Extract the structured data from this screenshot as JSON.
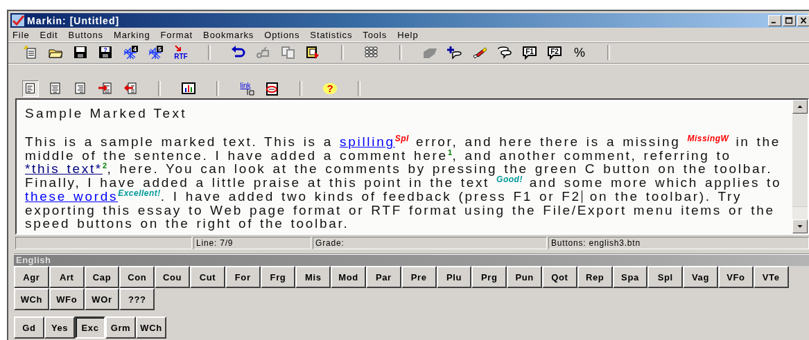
{
  "window": {
    "title": "Markin: [Untitled]"
  },
  "menu": [
    "File",
    "Edit",
    "Buttons",
    "Marking",
    "Format",
    "Bookmarks",
    "Options",
    "Statistics",
    "Tools",
    "Help"
  ],
  "toolbar_1": [
    {
      "kind": "new",
      "disabled": false
    },
    {
      "kind": "open",
      "disabled": false
    },
    {
      "kind": "save",
      "disabled": false
    },
    {
      "kind": "saveas",
      "label": "?",
      "disabled": false
    },
    {
      "kind": "web",
      "label": "4",
      "disabled": false
    },
    {
      "kind": "web",
      "label": "5",
      "disabled": false
    },
    {
      "kind": "rtf",
      "label": "RTF",
      "disabled": false
    },
    {
      "kind": "sep"
    },
    {
      "kind": "undo",
      "disabled": false
    },
    {
      "kind": "cut",
      "disabled": true
    },
    {
      "kind": "copy",
      "disabled": true
    },
    {
      "kind": "paste",
      "disabled": false
    },
    {
      "kind": "sep"
    },
    {
      "kind": "keypad",
      "disabled": false
    },
    {
      "kind": "sep"
    },
    {
      "kind": "shape",
      "disabled": true
    },
    {
      "kind": "addcomment",
      "disabled": false
    },
    {
      "kind": "highlight",
      "disabled": false
    },
    {
      "kind": "balloons",
      "disabled": false
    },
    {
      "kind": "fkey",
      "label": "F1",
      "disabled": false
    },
    {
      "kind": "fkey",
      "label": "F2",
      "disabled": false
    },
    {
      "kind": "percent",
      "label": "%",
      "disabled": false
    },
    {
      "kind": "sep"
    }
  ],
  "toolbar_2": [
    {
      "kind": "alignleft",
      "pressed": true
    },
    {
      "kind": "aligncenter",
      "pressed": false
    },
    {
      "kind": "alignright",
      "pressed": false
    },
    {
      "kind": "indent",
      "pressed": false
    },
    {
      "kind": "outdent",
      "pressed": false
    },
    {
      "kind": "sep"
    },
    {
      "kind": "chart",
      "pressed": false
    },
    {
      "kind": "sep"
    },
    {
      "kind": "link",
      "label": "link",
      "pressed": false
    },
    {
      "kind": "notepad",
      "pressed": false
    },
    {
      "kind": "sep"
    },
    {
      "kind": "help",
      "label": "?",
      "pressed": false
    },
    {
      "kind": "sep"
    }
  ],
  "editor": {
    "heading": "Sample Marked Text",
    "segments": [
      {
        "kind": "text",
        "text": "This is a sample marked text. This is a "
      },
      {
        "kind": "link",
        "text": "spilling",
        "color": "#0000ff"
      },
      {
        "kind": "mark",
        "text": "Spl",
        "color": "#ff0000"
      },
      {
        "kind": "text",
        "text": " error, and here there is a missing "
      },
      {
        "kind": "mark",
        "text": "MissingW",
        "color": "#ff0000"
      },
      {
        "kind": "text",
        "text": " in the middle of the sentence. I have added a comment here"
      },
      {
        "kind": "note",
        "text": "1",
        "color": "#008000"
      },
      {
        "kind": "text",
        "text": ", and another comment, referring to "
      },
      {
        "kind": "link",
        "text": "*this text*",
        "color": "#000080"
      },
      {
        "kind": "note",
        "text": "2",
        "color": "#008000"
      },
      {
        "kind": "text",
        "text": ", here. You can look at the comments by pressing the green C button on the toolbar. Finally, I have added a little praise at this point in the text "
      },
      {
        "kind": "mark",
        "text": "Good!",
        "color": "#009999"
      },
      {
        "kind": "text",
        "text": " and some more which applies to "
      },
      {
        "kind": "link",
        "text": "these words",
        "color": "#0000ff"
      },
      {
        "kind": "mark",
        "text": "Excellent!",
        "color": "#009999"
      },
      {
        "kind": "text",
        "text": ". I have added two kinds of feedback (press F1 or F2"
      },
      {
        "kind": "caret"
      },
      {
        "kind": "text",
        "text": " on the toolbar). Try exporting this essay to Web page format or RTF format using the File/Export menu items or the speed buttons on the right of the toolbar."
      }
    ]
  },
  "status_bar": {
    "line": "Line:  7/9",
    "grade": "Grade:",
    "buttons": "Buttons: english3.btn"
  },
  "button_panel": {
    "title": "English",
    "groups": [
      [
        {
          "label": "Agr",
          "pressed": false
        },
        {
          "label": "Art",
          "pressed": false
        },
        {
          "label": "Cap",
          "pressed": false
        },
        {
          "label": "Con",
          "pressed": false
        },
        {
          "label": "Cou",
          "pressed": false
        },
        {
          "label": "Cut",
          "pressed": false
        },
        {
          "label": "For",
          "pressed": false
        },
        {
          "label": "Frg",
          "pressed": false
        },
        {
          "label": "Mis",
          "pressed": false
        },
        {
          "label": "Mod",
          "pressed": false
        },
        {
          "label": "Par",
          "pressed": false
        },
        {
          "label": "Pre",
          "pressed": false
        },
        {
          "label": "Plu",
          "pressed": false
        },
        {
          "label": "Prg",
          "pressed": false
        },
        {
          "label": "Pun",
          "pressed": false
        },
        {
          "label": "Qot",
          "pressed": false
        },
        {
          "label": "Rep",
          "pressed": false
        },
        {
          "label": "Spa",
          "pressed": false
        },
        {
          "label": "Spl",
          "pressed": false
        },
        {
          "label": "Vag",
          "pressed": false
        },
        {
          "label": "VFo",
          "pressed": false
        },
        {
          "label": "VTe",
          "pressed": false
        },
        {
          "label": "WCh",
          "pressed": false
        },
        {
          "label": "WFo",
          "pressed": false
        },
        {
          "label": "WOr",
          "pressed": false
        },
        {
          "label": "???",
          "pressed": false
        }
      ],
      [
        {
          "label": "Gd",
          "pressed": false
        },
        {
          "label": "Yes",
          "pressed": false
        },
        {
          "label": "Exc",
          "pressed": true
        },
        {
          "label": "Grm",
          "pressed": false
        },
        {
          "label": "WCh",
          "pressed": false
        }
      ]
    ]
  }
}
